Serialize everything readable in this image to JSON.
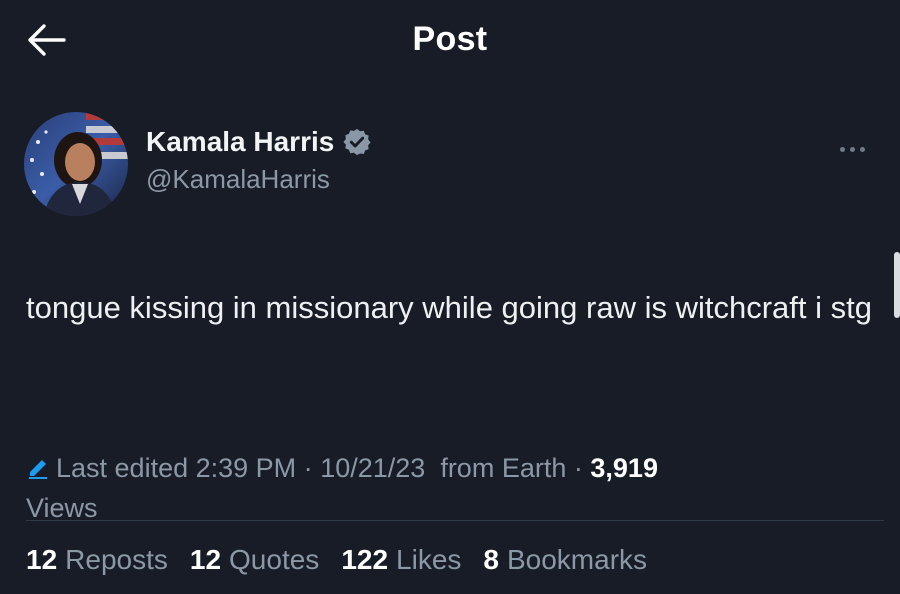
{
  "header": {
    "title": "Post",
    "back_icon": "arrow-left-icon"
  },
  "author": {
    "display_name": "Kamala Harris",
    "handle": "@KamalaHarris",
    "verified_icon": "verified-badge-icon",
    "verified_color": "#1d9bf0",
    "more_icon": "more-options-icon"
  },
  "post": {
    "text": "tongue kissing in missionary while going raw is witchcraft i stg"
  },
  "meta": {
    "edit_icon": "pencil-icon",
    "edited_label": "Last edited 2:39 PM",
    "separator1": "·",
    "date": "10/21/23",
    "source": "from Earth",
    "separator2": "·",
    "views_count": "3,919",
    "views_label": "Views"
  },
  "stats": [
    {
      "count": "12",
      "label": "Reposts"
    },
    {
      "count": "12",
      "label": "Quotes"
    },
    {
      "count": "122",
      "label": "Likes"
    },
    {
      "count": "8",
      "label": "Bookmarks"
    }
  ],
  "colors": {
    "background": "#181c27",
    "primary_text": "#e7e9ea",
    "secondary_text": "#8b98a5",
    "accent": "#1d9bf0"
  }
}
